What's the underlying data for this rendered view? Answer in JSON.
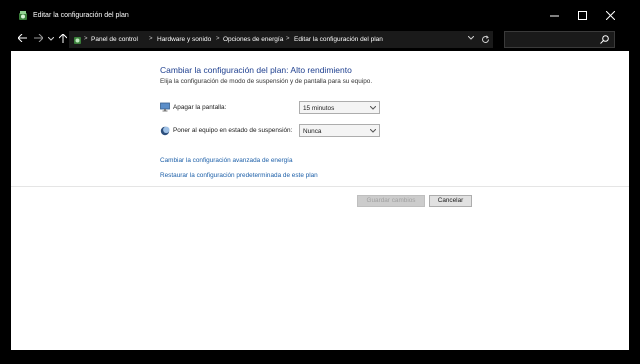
{
  "window": {
    "title": "Editar la configuración del plan",
    "minimize_icon": "minimize-icon",
    "maximize_icon": "maximize-icon",
    "close_icon": "close-icon"
  },
  "address_bar": {
    "breadcrumbs": [
      "Panel de control",
      "Hardware y sonido",
      "Opciones de energía",
      "Editar la configuración del plan"
    ],
    "separator": ">",
    "search_placeholder": ""
  },
  "content": {
    "heading": "Cambiar la configuración del plan: Alto rendimiento",
    "subtext": "Elija la configuración de modo de suspensión y de pantalla para su equipo.",
    "settings": [
      {
        "label": "Apagar la pantalla:",
        "value": "15 minutos",
        "icon": "monitor-icon"
      },
      {
        "label": "Poner al equipo en estado de suspensión:",
        "value": "Nunca",
        "icon": "sleep-moon-icon"
      }
    ],
    "links": [
      "Cambiar la configuración avanzada de energía",
      "Restaurar la configuración predeterminada de este plan"
    ],
    "buttons": {
      "save": "Guardar cambios",
      "cancel": "Cancelar"
    }
  },
  "colors": {
    "heading": "#1e3f8f",
    "link": "#1c5fa8",
    "titlebar": "#000000"
  }
}
